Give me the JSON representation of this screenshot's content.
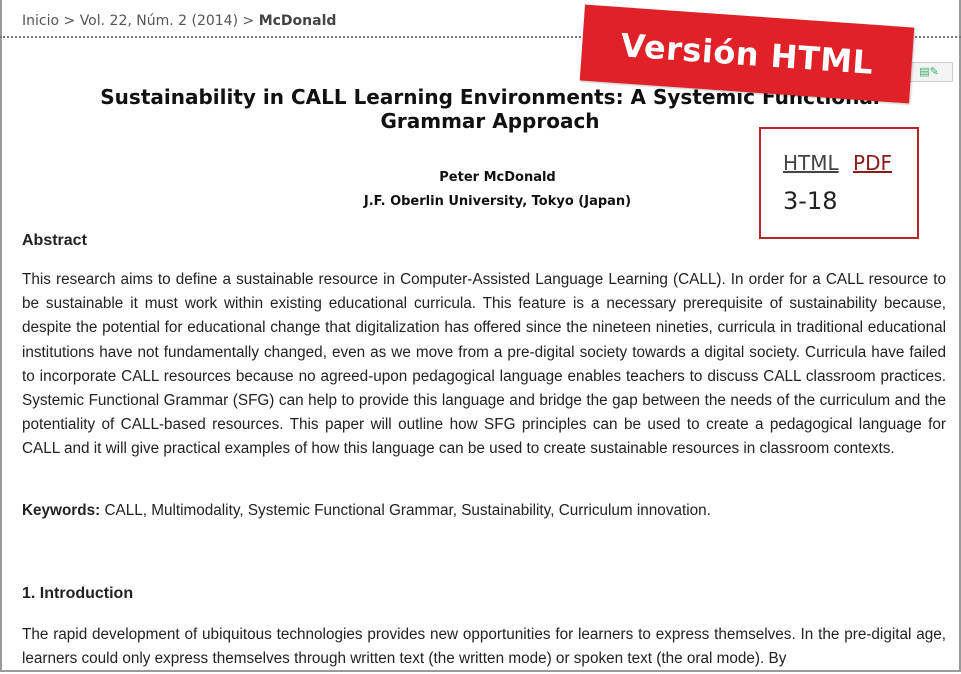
{
  "breadcrumb": {
    "home": "Inicio",
    "sep1": ">",
    "issue": "Vol. 22, Núm. 2 (2014)",
    "sep2": ">",
    "current": "McDonald"
  },
  "article": {
    "title_line1": "Sustainability in CALL Learning Environments: A Systemic Functional",
    "title_line2": "Grammar Approach",
    "author": "Peter McDonald",
    "affiliation": "J.F. Oberlin University, Tokyo (Japan)"
  },
  "galleys": {
    "html_label": "HTML",
    "pdf_label": "PDF",
    "pages": "3-18"
  },
  "banner": {
    "text": "Versión HTML",
    "color": "#e02127"
  },
  "abstract": {
    "heading": "Abstract",
    "text": "This research aims to define a sustainable resource in Computer-Assisted Language Learning (CALL). In order for a CALL resource to be sustainable it must work within existing educational curricula. This feature is a necessary prerequisite of sustainability because, despite the potential for educational change that digitalization has offered since the nineteen nineties, curricula in traditional educational institutions have not fundamentally changed, even as we move from a pre-digital society towards a digital society. Curricula have failed to incorporate CALL resources because no agreed-upon pedagogical language enables teachers to discuss CALL classroom practices. Systemic Functional Grammar (SFG) can help to provide this language and bridge the gap between the needs of the curriculum and the potentiality of CALL-based resources. This paper will outline how SFG principles can be used to create a pedagogical language for CALL and it will give practical examples of how this language can be used to create sustainable resources in classroom contexts."
  },
  "keywords": {
    "label": "Keywords:",
    "text": "CALL, Multimodality, Systemic Functional Grammar, Sustainability, Curriculum innovation."
  },
  "introduction": {
    "heading": "1. Introduction",
    "text": "The rapid development of ubiquitous technologies provides new opportunities for learners to express themselves. In the pre-digital age, learners could only express themselves through written text (the written mode) or spoken text (the oral mode). By"
  }
}
